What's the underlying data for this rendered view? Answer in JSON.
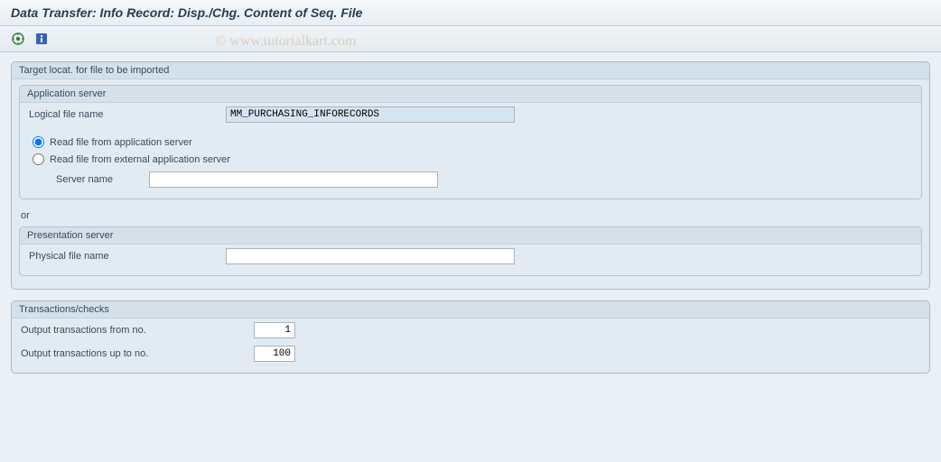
{
  "title": "Data Transfer: Info Record: Disp./Chg. Content of Seq. File",
  "watermark": "© www.tutorialkart.com",
  "group1": {
    "title": "Target locat. for file to be imported",
    "app_server": {
      "title": "Application server",
      "logical_file_label": "Logical file name",
      "logical_file_value": "MM_PURCHASING_INFORECORDS",
      "radio1_label": "Read file from application server",
      "radio2_label": "Read file from external application server",
      "server_name_label": "Server name",
      "server_name_value": ""
    },
    "or_text": "or",
    "pres_server": {
      "title": "Presentation server",
      "physical_file_label": "Physical file name",
      "physical_file_value": ""
    }
  },
  "group2": {
    "title": "Transactions/checks",
    "from_label": "Output transactions from no.",
    "from_value": "1",
    "to_label": "Output transactions up to no.",
    "to_value": "100"
  }
}
